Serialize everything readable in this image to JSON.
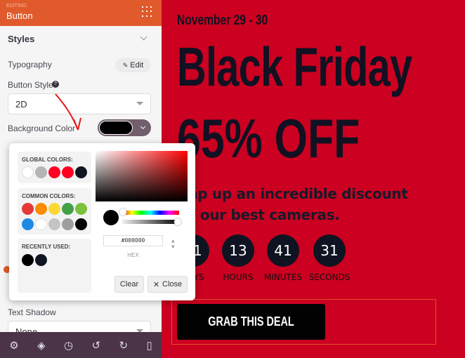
{
  "sidebar": {
    "editing_label": "EDITING:",
    "editing_title": "Button",
    "section": "Styles",
    "typography_label": "Typography",
    "edit_label": "Edit",
    "button_style_label": "Button Style",
    "button_style_value": "2D",
    "bg_color_label": "Background Color",
    "bg_color_value": "#000000",
    "text_shadow_label": "Text Shadow",
    "text_shadow_value": "None",
    "toolbar": [
      "settings-icon",
      "layers-icon",
      "history-icon",
      "undo-icon",
      "redo-icon",
      "tablet-preview-icon"
    ]
  },
  "picker": {
    "global_label": "GLOBAL COLORS:",
    "global": [
      "#ffffff",
      "#b5b5b5",
      "#ff0022",
      "#ff0022",
      "#111522"
    ],
    "common_label": "COMMON COLORS:",
    "common": [
      "#e53935",
      "#fb8c00",
      "#fdd835",
      "#43a047",
      "#7cc13e",
      "#1e88e5",
      "#ffffff",
      "#c4c4c4",
      "#9e9e9e",
      "#000000"
    ],
    "recent_label": "RECENTLY USED:",
    "recent": [
      "#000000",
      "#111522"
    ],
    "hex_value": "#000000",
    "hex_label": "HEX",
    "clear": "Clear",
    "close": "Close",
    "close_glyph": "✕"
  },
  "canvas": {
    "date": "November 29 - 30",
    "headline": "Black Friday",
    "offer": "65% OFF",
    "line1": "Snap up an incredible discount",
    "line2": "off our best cameras.",
    "countdown": [
      {
        "value": "71",
        "label": "DAYS"
      },
      {
        "value": "13",
        "label": "HOURS"
      },
      {
        "value": "41",
        "label": "MINUTES"
      },
      {
        "value": "31",
        "label": "SECONDS"
      }
    ],
    "cta": "GRAB THIS DEAL",
    "bg_color": "#cc0020"
  }
}
